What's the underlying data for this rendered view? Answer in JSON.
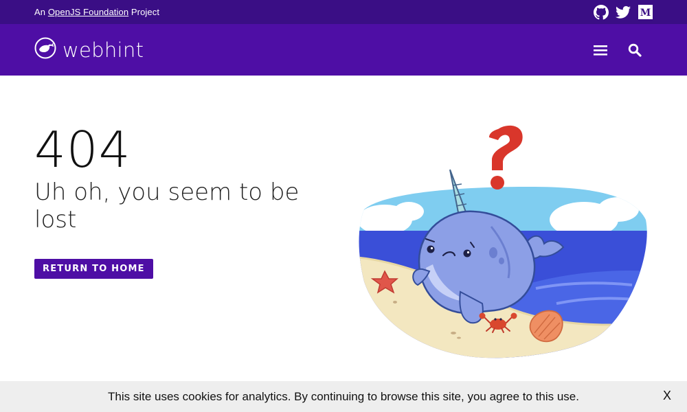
{
  "topbar": {
    "prefix": "An",
    "foundation_link": "OpenJS Foundation",
    "suffix": "Project",
    "social": [
      {
        "icon": "github-icon"
      },
      {
        "icon": "twitter-icon"
      },
      {
        "icon": "medium-icon"
      }
    ]
  },
  "navbar": {
    "brand_name": "webhint",
    "menu_icon": "hamburger-menu-icon",
    "search_icon": "search-icon"
  },
  "main": {
    "code": "404",
    "headline": "Uh oh, you seem to be lost",
    "home_button": "RETURN TO HOME"
  },
  "cookie": {
    "message": "This site uses cookies for analytics. By continuing to browse this site, you agree to this use.",
    "close_label": "X"
  },
  "colors": {
    "topbar": "#3a0e85",
    "navbar": "#4e0ea5",
    "button": "#4e0ea5",
    "cookie_bg": "#eeeeee"
  }
}
